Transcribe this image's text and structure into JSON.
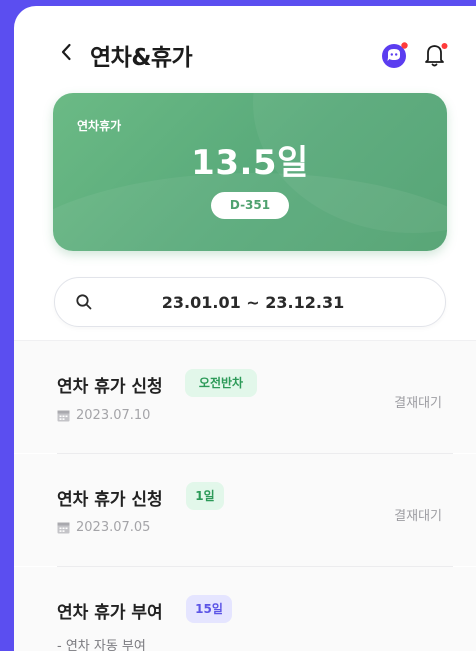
{
  "header": {
    "title": "연차&휴가"
  },
  "summary": {
    "label": "연차휴가",
    "days": "13.5일",
    "dday": "D-351"
  },
  "search": {
    "range": "23.01.01 ~ 23.12.31"
  },
  "colors": {
    "card_green": "#58a97a",
    "tag_green_bg": "#e2f7ea",
    "tag_green_text": "#2c9a58",
    "tag_purple_bg": "#e5e5ff",
    "tag_purple_text": "#5c55e6",
    "notification_dot": "#ff3b3b",
    "chat_purple": "#5b3df0"
  },
  "icons": {
    "back": "chevron-left-icon",
    "chat": "chat-bubble-icon",
    "bell": "bell-icon",
    "search": "search-icon",
    "calendar": "calendar-icon"
  },
  "items": [
    {
      "title": "연차 휴가 신청",
      "tag": "오전반차",
      "date": "2023.07.10",
      "status": "결재대기"
    },
    {
      "title": "연차 휴가 신청",
      "tag": "1일",
      "date": "2023.07.05",
      "status": "결재대기"
    },
    {
      "title": "연차 휴가 부여",
      "tag": "15일",
      "sub": "- 연차 자동 부여"
    }
  ]
}
